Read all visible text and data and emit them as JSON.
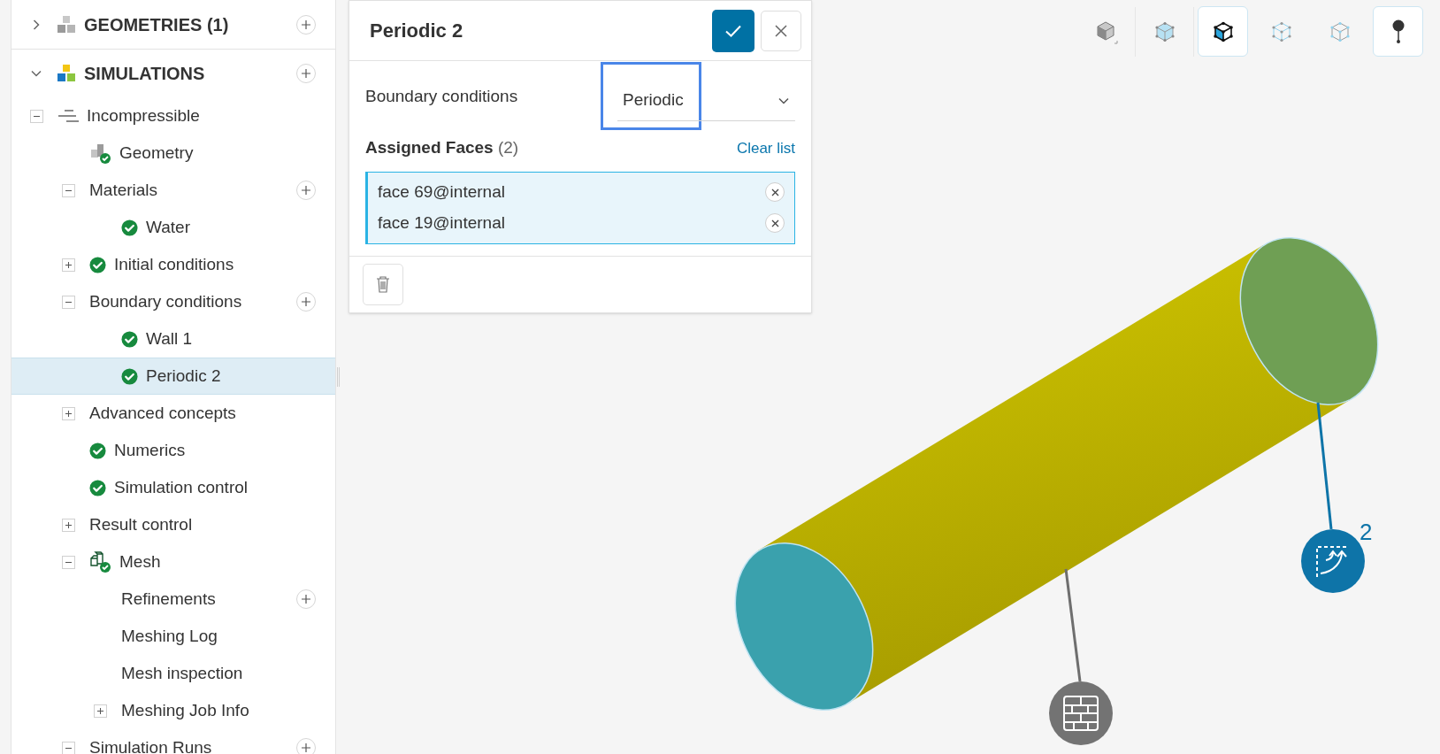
{
  "sidebar": {
    "sections": [
      {
        "kind": "geometries",
        "label": "GEOMETRIES (1)",
        "expanded": false,
        "add": true
      },
      {
        "kind": "simulations",
        "label": "SIMULATIONS",
        "expanded": true,
        "add": true,
        "children": [
          {
            "label": "Incompressible",
            "kind": "setup",
            "expanded": true,
            "selected": false,
            "children": [
              {
                "label": "Geometry",
                "kind": "geometry",
                "selected": false
              },
              {
                "label": "Materials",
                "expanded": true,
                "add": true,
                "selected": false,
                "children": [
                  {
                    "label": "Water",
                    "kind": "check",
                    "selected": false
                  }
                ]
              },
              {
                "label": "Initial conditions",
                "kind": "check",
                "expanded": false,
                "selected": false
              },
              {
                "label": "Boundary conditions",
                "expanded": true,
                "add": true,
                "selected": false,
                "children": [
                  {
                    "label": "Wall 1",
                    "kind": "check",
                    "selected": false
                  },
                  {
                    "label": "Periodic 2",
                    "kind": "check",
                    "selected": true
                  }
                ]
              },
              {
                "label": "Advanced concepts",
                "expanded": false,
                "selected": false
              },
              {
                "label": "Numerics",
                "kind": "check",
                "selected": false
              },
              {
                "label": "Simulation control",
                "kind": "check",
                "selected": false
              },
              {
                "label": "Result control",
                "expanded": false,
                "selected": false
              },
              {
                "label": "Mesh",
                "kind": "mesh",
                "expanded": true,
                "selected": false,
                "children": [
                  {
                    "label": "Refinements",
                    "add": true,
                    "selected": false
                  },
                  {
                    "label": "Meshing Log",
                    "selected": false
                  },
                  {
                    "label": "Mesh inspection",
                    "selected": false
                  },
                  {
                    "label": "Meshing Job Info",
                    "expanded": false,
                    "selected": false
                  }
                ]
              },
              {
                "label": "Simulation Runs",
                "expanded": true,
                "add": true,
                "selected": false
              }
            ]
          }
        ]
      }
    ]
  },
  "panel": {
    "title": "Periodic 2",
    "field_label": "Boundary conditions",
    "select": {
      "value": "Periodic",
      "focused": true
    },
    "assigned": {
      "label": "Assigned Faces",
      "count": "(2)",
      "clear": "Clear list",
      "faces": [
        "face 69@internal",
        "face 19@internal"
      ]
    }
  },
  "toolbar": [
    {
      "kind": "solid",
      "selected": false
    },
    {
      "kind": "shaded",
      "selected": false
    },
    {
      "kind": "faces",
      "selected": true
    },
    {
      "kind": "edges",
      "selected": false
    },
    {
      "kind": "vertices",
      "selected": false
    },
    {
      "kind": "pin",
      "selected": true
    }
  ],
  "markers": [
    {
      "kind": "periodic",
      "label": "2"
    },
    {
      "kind": "wall"
    }
  ]
}
